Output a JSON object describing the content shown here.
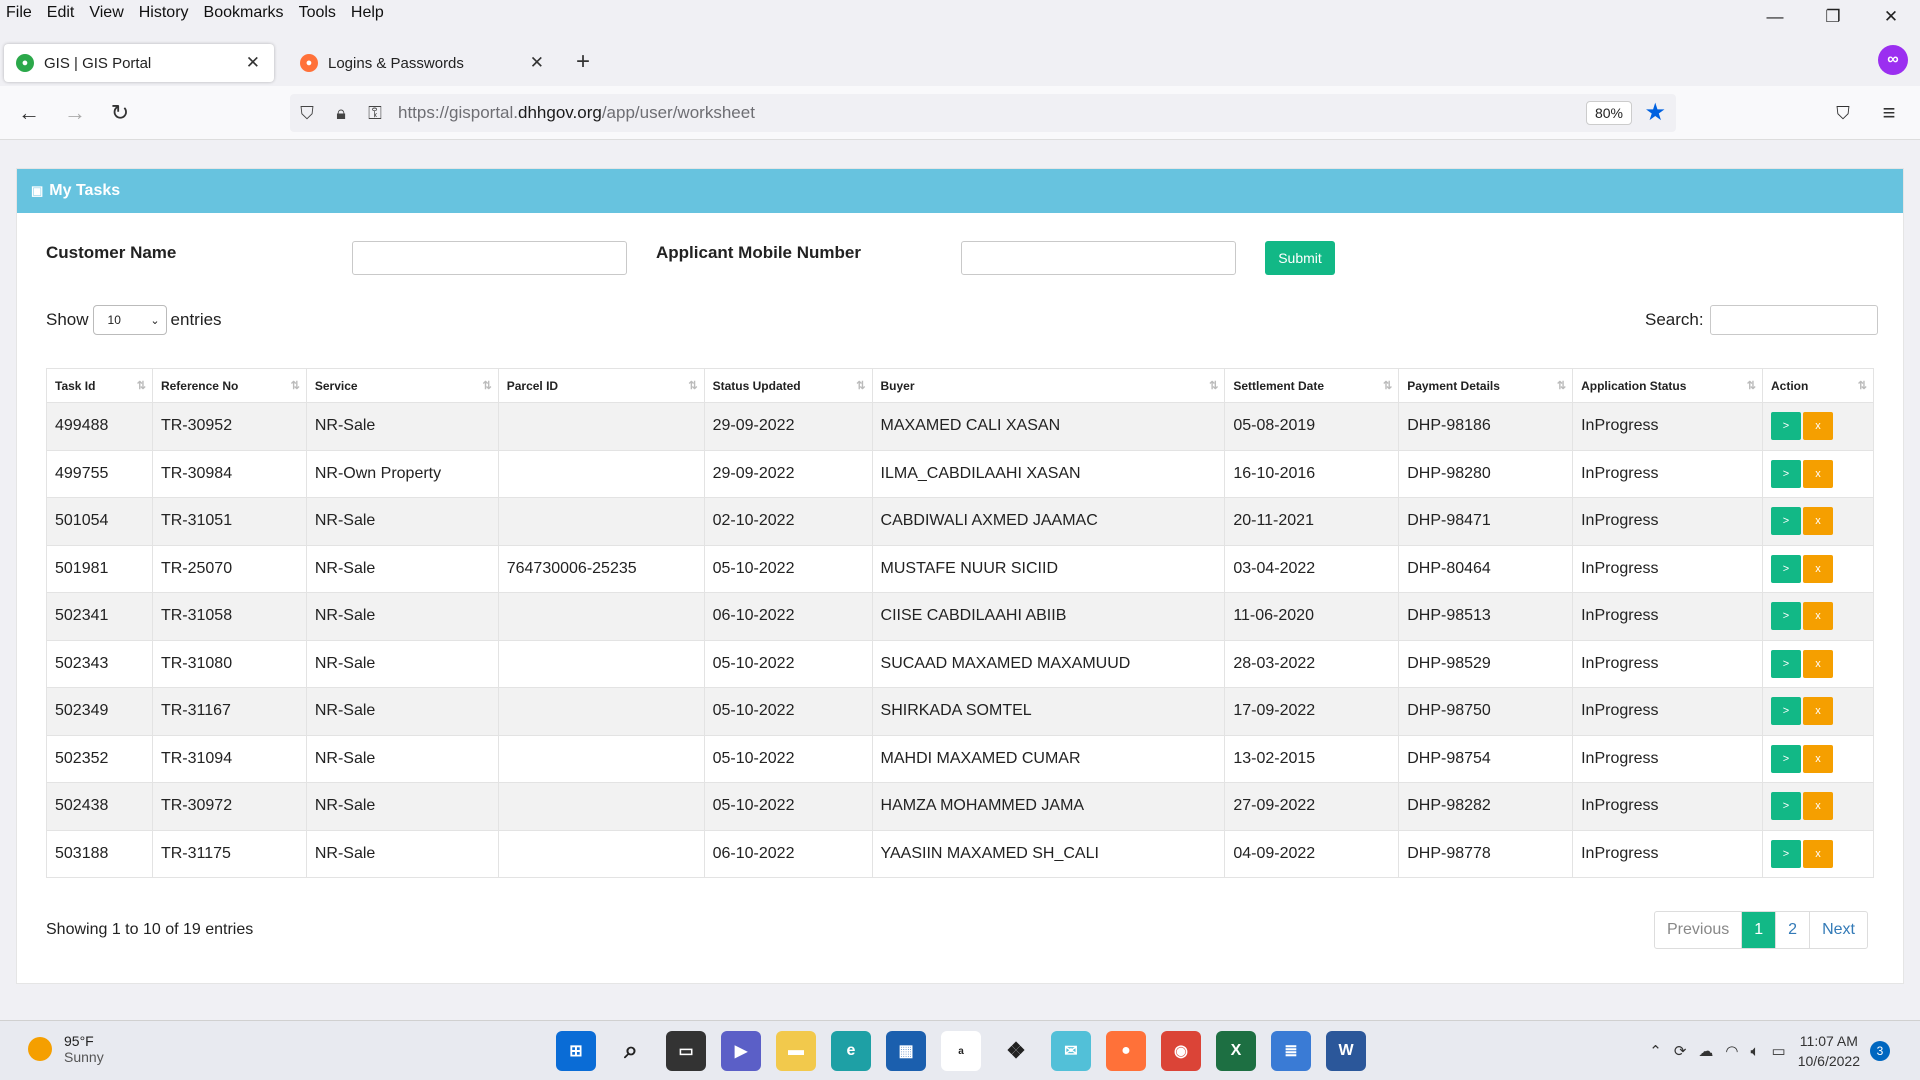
{
  "menu": [
    "File",
    "Edit",
    "View",
    "History",
    "Bookmarks",
    "Tools",
    "Help"
  ],
  "window": {
    "minimize": "—",
    "restore": "❐",
    "close": "✕"
  },
  "tabs": [
    {
      "title": "GIS | GIS Portal",
      "close": "✕"
    },
    {
      "title": "Logins & Passwords",
      "close": "✕"
    }
  ],
  "nav": {
    "url_prefix": "https://gisportal.",
    "url_domain": "dhhgov.org",
    "url_path": "/app/user/worksheet",
    "zoom": "80%"
  },
  "page": {
    "title": "My Tasks",
    "customer_name_label": "Customer Name",
    "mobile_label": "Applicant Mobile Number",
    "submit_label": "Submit",
    "show_label": "Show",
    "entries_value": "10",
    "entries_label": "entries",
    "search_label": "Search:",
    "info": "Showing 1 to 10 of 19 entries",
    "pager": {
      "previous": "Previous",
      "page1": "1",
      "page2": "2",
      "next": "Next"
    }
  },
  "table": {
    "headers": [
      "Task Id",
      "Reference No",
      "Service",
      "Parcel ID",
      "Status Updated",
      "Buyer",
      "Settlement Date",
      "Payment Details",
      "Application Status",
      "Action"
    ],
    "rows": [
      [
        "499488",
        "TR-30952",
        "NR-Sale",
        "",
        "29-09-2022",
        "MAXAMED CALI XASAN",
        "05-08-2019",
        "DHP-98186",
        "InProgress"
      ],
      [
        "499755",
        "TR-30984",
        "NR-Own Property",
        "",
        "29-09-2022",
        "ILMA_CABDILAAHI XASAN",
        "16-10-2016",
        "DHP-98280",
        "InProgress"
      ],
      [
        "501054",
        "TR-31051",
        "NR-Sale",
        "",
        "02-10-2022",
        "CABDIWALI AXMED JAAMAC",
        "20-11-2021",
        "DHP-98471",
        "InProgress"
      ],
      [
        "501981",
        "TR-25070",
        "NR-Sale",
        "764730006-25235",
        "05-10-2022",
        "MUSTAFE NUUR SICIID",
        "03-04-2022",
        "DHP-80464",
        "InProgress"
      ],
      [
        "502341",
        "TR-31058",
        "NR-Sale",
        "",
        "06-10-2022",
        "CIISE CABDILAAHI ABIIB",
        "11-06-2020",
        "DHP-98513",
        "InProgress"
      ],
      [
        "502343",
        "TR-31080",
        "NR-Sale",
        "",
        "05-10-2022",
        "SUCAAD MAXAMED MAXAMUUD",
        "28-03-2022",
        "DHP-98529",
        "InProgress"
      ],
      [
        "502349",
        "TR-31167",
        "NR-Sale",
        "",
        "05-10-2022",
        "SHIRKADA SOMTEL",
        "17-09-2022",
        "DHP-98750",
        "InProgress"
      ],
      [
        "502352",
        "TR-31094",
        "NR-Sale",
        "",
        "05-10-2022",
        "MAHDI MAXAMED CUMAR",
        "13-02-2015",
        "DHP-98754",
        "InProgress"
      ],
      [
        "502438",
        "TR-30972",
        "NR-Sale",
        "",
        "05-10-2022",
        "HAMZA MOHAMMED JAMA",
        "27-09-2022",
        "DHP-98282",
        "InProgress"
      ],
      [
        "503188",
        "TR-31175",
        "NR-Sale",
        "",
        "06-10-2022",
        "YAASIIN MAXAMED SH_CALI",
        "04-09-2022",
        "DHP-98778",
        "InProgress"
      ]
    ],
    "action_go": ">",
    "action_remove": "x"
  },
  "taskbar": {
    "temp": "95°F",
    "condition": "Sunny",
    "time": "11:07 AM",
    "date": "10/6/2022",
    "notifications": "3"
  },
  "colors": {
    "header": "#67c3df",
    "submit": "#12b886",
    "remove": "#f59f00"
  }
}
